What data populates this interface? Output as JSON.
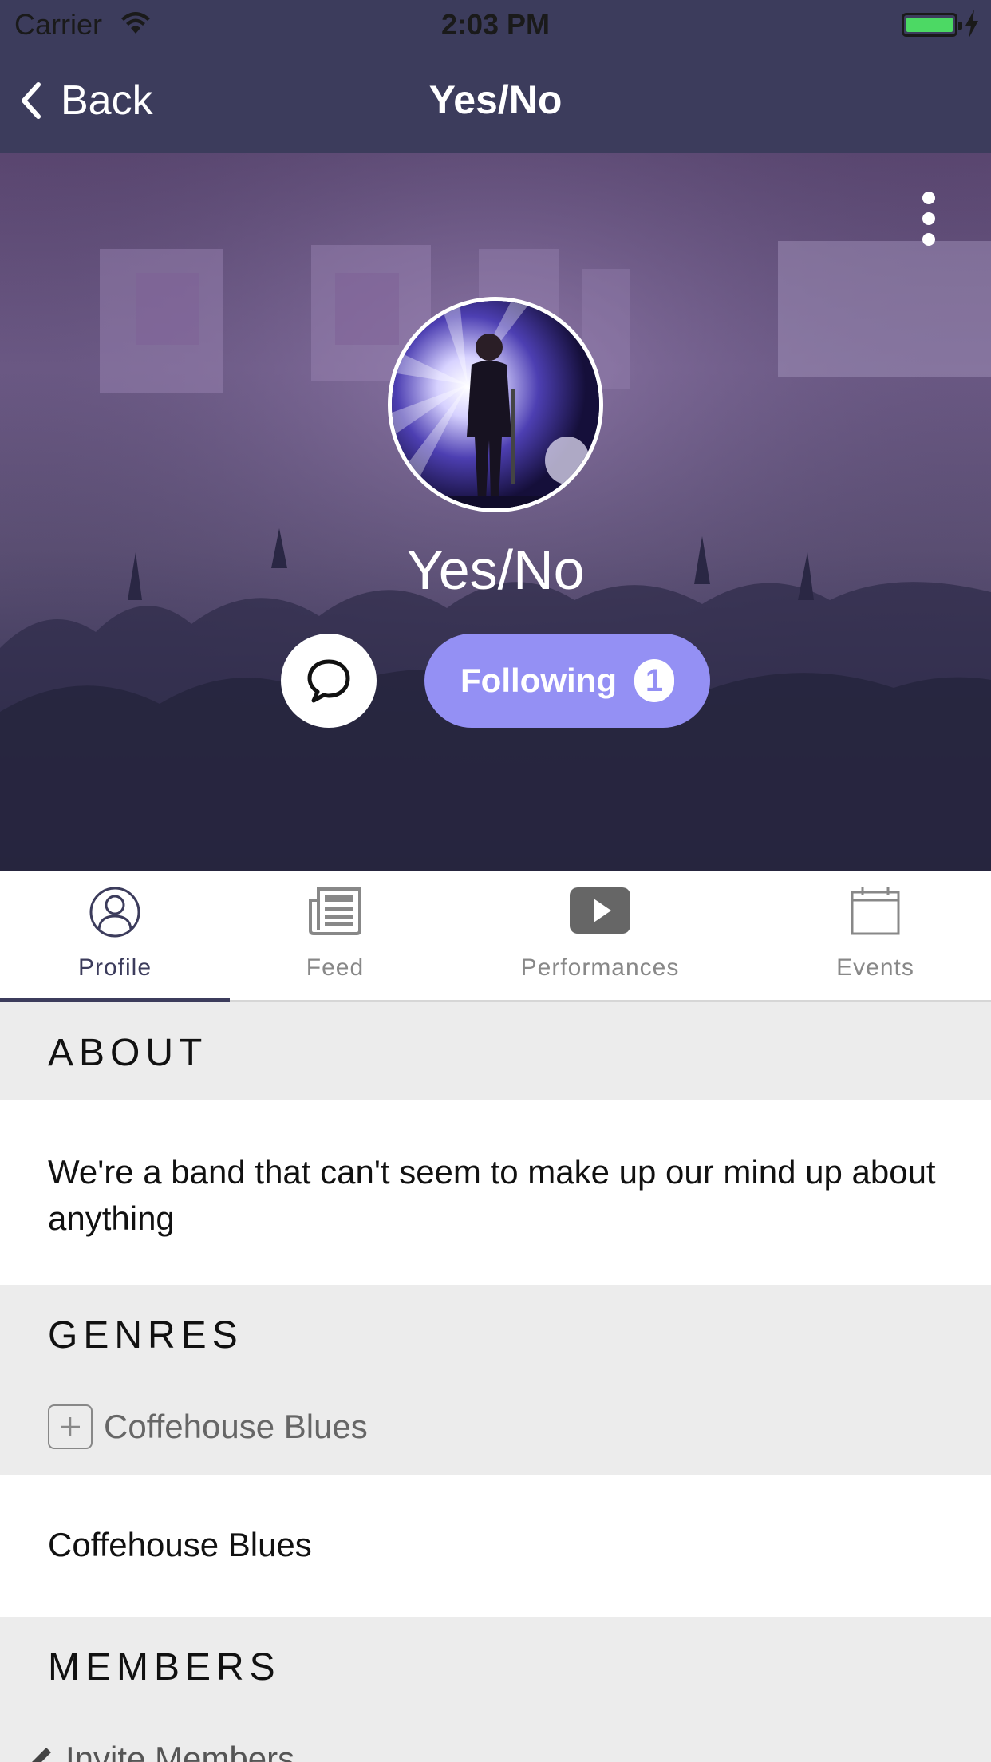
{
  "status": {
    "carrier": "Carrier",
    "time": "2:03 PM"
  },
  "nav": {
    "back_label": "Back",
    "title": "Yes/No"
  },
  "profile": {
    "name": "Yes/No",
    "follow_label": "Following",
    "follow_count": "1"
  },
  "tabs": [
    {
      "label": "Profile",
      "icon": "person-circle-icon",
      "active": true
    },
    {
      "label": "Feed",
      "icon": "newspaper-icon",
      "active": false
    },
    {
      "label": "Performances",
      "icon": "play-icon",
      "active": false
    },
    {
      "label": "Events",
      "icon": "calendar-icon",
      "active": false
    }
  ],
  "about": {
    "title": "ABOUT",
    "text": "We're a band that can't seem to make up our mind up about anything"
  },
  "genres": {
    "title": "GENRES",
    "chip_label": "Coffehouse Blues",
    "items": [
      "Coffehouse Blues"
    ]
  },
  "members": {
    "title": "MEMBERS",
    "invite_label": "Invite Members"
  },
  "colors": {
    "nav_bg": "#3c3c5c",
    "accent": "#9490f4",
    "section_bg": "#ececec"
  }
}
